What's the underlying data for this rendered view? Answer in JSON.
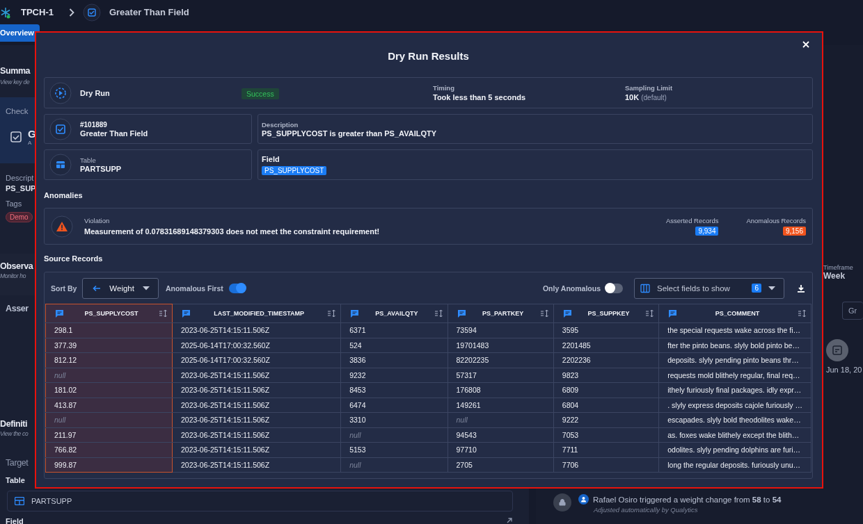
{
  "header": {
    "breadcrumbs": [
      {
        "text": "TPCH-1"
      },
      {
        "text": "Greater Than Field"
      }
    ]
  },
  "tabs": [
    {
      "label": "Overview",
      "selected": true
    }
  ],
  "left_panel": {
    "summary_title": "Summa",
    "summary_subtitle": "View key de",
    "check_label": "Check",
    "check_name": "G",
    "check_sub": "A",
    "description_label": "Descript",
    "description_value": "PS_SUP",
    "tags_label": "Tags",
    "tags": [
      "Demo"
    ],
    "observability_title": "Observa",
    "observability_subtitle": "Monitor ho",
    "assertions_title": "Asser",
    "definition_title": "Definiti",
    "definition_subtitle": "View the co",
    "target_title": "Target",
    "table_label": "Table",
    "table_value": "PARTSUPP",
    "field_label": "Field"
  },
  "right_panel": {
    "timeframe_label": "Timeframe",
    "timeframe_value": "Week",
    "group_button": "Gr",
    "event_date": "Jun 18, 20",
    "activity": {
      "text": "Rafael Osiro triggered a weight change from **58** to **54**",
      "note": "Adjusted automatically by Qualytics"
    }
  },
  "modal": {
    "title": "Dry Run Results",
    "summary": {
      "name": "Dry Run",
      "status": "Success",
      "timing_label": "Timing",
      "timing_value": "Took less than 5 seconds",
      "sampling_label": "Sampling Limit",
      "sampling_value": "10K",
      "sampling_note": "(default)"
    },
    "check": {
      "id": "#101889",
      "name": "Greater Than Field"
    },
    "description": {
      "label": "Description",
      "value": "PS_SUPPLYCOST is greater than PS_AVAILQTY"
    },
    "table": {
      "label": "Table",
      "value": "PARTSUPP"
    },
    "field": {
      "label": "Field",
      "tag": "PS_SUPPLYCOST"
    },
    "anomalies_title": "Anomalies",
    "violation": {
      "label": "Violation",
      "message": "Measurement of 0.07831689148379303 does not meet the constraint requirement!",
      "counts": [
        {
          "label": "Asserted Records",
          "value": "9,934",
          "color": "#1a7cf5"
        },
        {
          "label": "Anomalous Records",
          "value": "9,156",
          "color": "#f0541e"
        }
      ]
    },
    "source_records_title": "Source Records",
    "toolbar": {
      "sort_label": "Sort By",
      "sort_value": "Weight",
      "anomalous_first": {
        "label": "Anomalous First",
        "on": true
      },
      "only_anomalous": {
        "label": "Only Anomalous",
        "on": false
      },
      "fields_placeholder": "Select fields to show",
      "fields_count": "6"
    },
    "columns": [
      {
        "name": "PS_SUPPLYCOST",
        "anomalous": true
      },
      {
        "name": "LAST_MODIFIED_TIMESTAMP",
        "anomalous": false
      },
      {
        "name": "PS_AVAILQTY",
        "anomalous": false
      },
      {
        "name": "PS_PARTKEY",
        "anomalous": false
      },
      {
        "name": "PS_SUPPKEY",
        "anomalous": false
      },
      {
        "name": "PS_COMMENT",
        "anomalous": false
      }
    ],
    "rows": [
      [
        "298.1",
        "2023-06-25T14:15:11.506Z",
        "6371",
        "73594",
        "3595",
        "the special requests wake across the fi…"
      ],
      [
        "377.39",
        "2025-06-14T17:00:32.560Z",
        "524",
        "19701483",
        "2201485",
        "fter the pinto beans. slyly bold pinto be…"
      ],
      [
        "812.12",
        "2025-06-14T17:00:32.560Z",
        "3836",
        "82202235",
        "2202236",
        "deposits. slyly pending pinto beans thr…"
      ],
      [
        {
          "text": "null",
          "empty": true
        },
        "2023-06-25T14:15:11.506Z",
        "9232",
        "57317",
        "9823",
        "requests mold blithely regular, final req…"
      ],
      [
        "181.02",
        "2023-06-25T14:15:11.506Z",
        "8453",
        "176808",
        "6809",
        "ithely furiously final packages. idly expr…"
      ],
      [
        "413.87",
        "2023-06-25T14:15:11.506Z",
        "6474",
        "149261",
        "6804",
        ". slyly express deposits cajole furiously …"
      ],
      [
        {
          "text": "null",
          "empty": true
        },
        "2023-06-25T14:15:11.506Z",
        "3310",
        {
          "text": "null",
          "empty": true
        },
        "9222",
        "escapades. slyly bold theodolites wake…"
      ],
      [
        "211.97",
        "2023-06-25T14:15:11.506Z",
        {
          "text": "null",
          "empty": true
        },
        "94543",
        "7053",
        "as. foxes wake blithely except the blith…"
      ],
      [
        "766.82",
        "2023-06-25T14:15:11.506Z",
        "5153",
        "97710",
        "7711",
        "odolites. slyly pending dolphins are furi…"
      ],
      [
        "999.87",
        "2023-06-25T14:15:11.506Z",
        {
          "text": "null",
          "empty": true
        },
        "2705",
        "7706",
        "long the regular deposits. furiously unu…"
      ]
    ]
  }
}
